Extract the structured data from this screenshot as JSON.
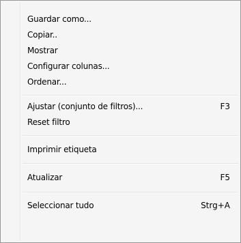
{
  "menu": {
    "items": [
      {
        "label": "Guardar como...",
        "shortcut": ""
      },
      {
        "label": "Copiar..",
        "shortcut": ""
      },
      {
        "label": "Mostrar",
        "shortcut": ""
      },
      {
        "label": "Configurar colunas...",
        "shortcut": ""
      },
      {
        "label": "Ordenar...",
        "shortcut": ""
      },
      {
        "label": "Ajustar (conjunto de filtros)...",
        "shortcut": "F3"
      },
      {
        "label": "Reset filtro",
        "shortcut": ""
      },
      {
        "label": "Imprimir etiqueta",
        "shortcut": ""
      },
      {
        "label": "Atualizar",
        "shortcut": "F5"
      },
      {
        "label": "Seleccionar tudo",
        "shortcut": "Strg+A"
      }
    ]
  }
}
